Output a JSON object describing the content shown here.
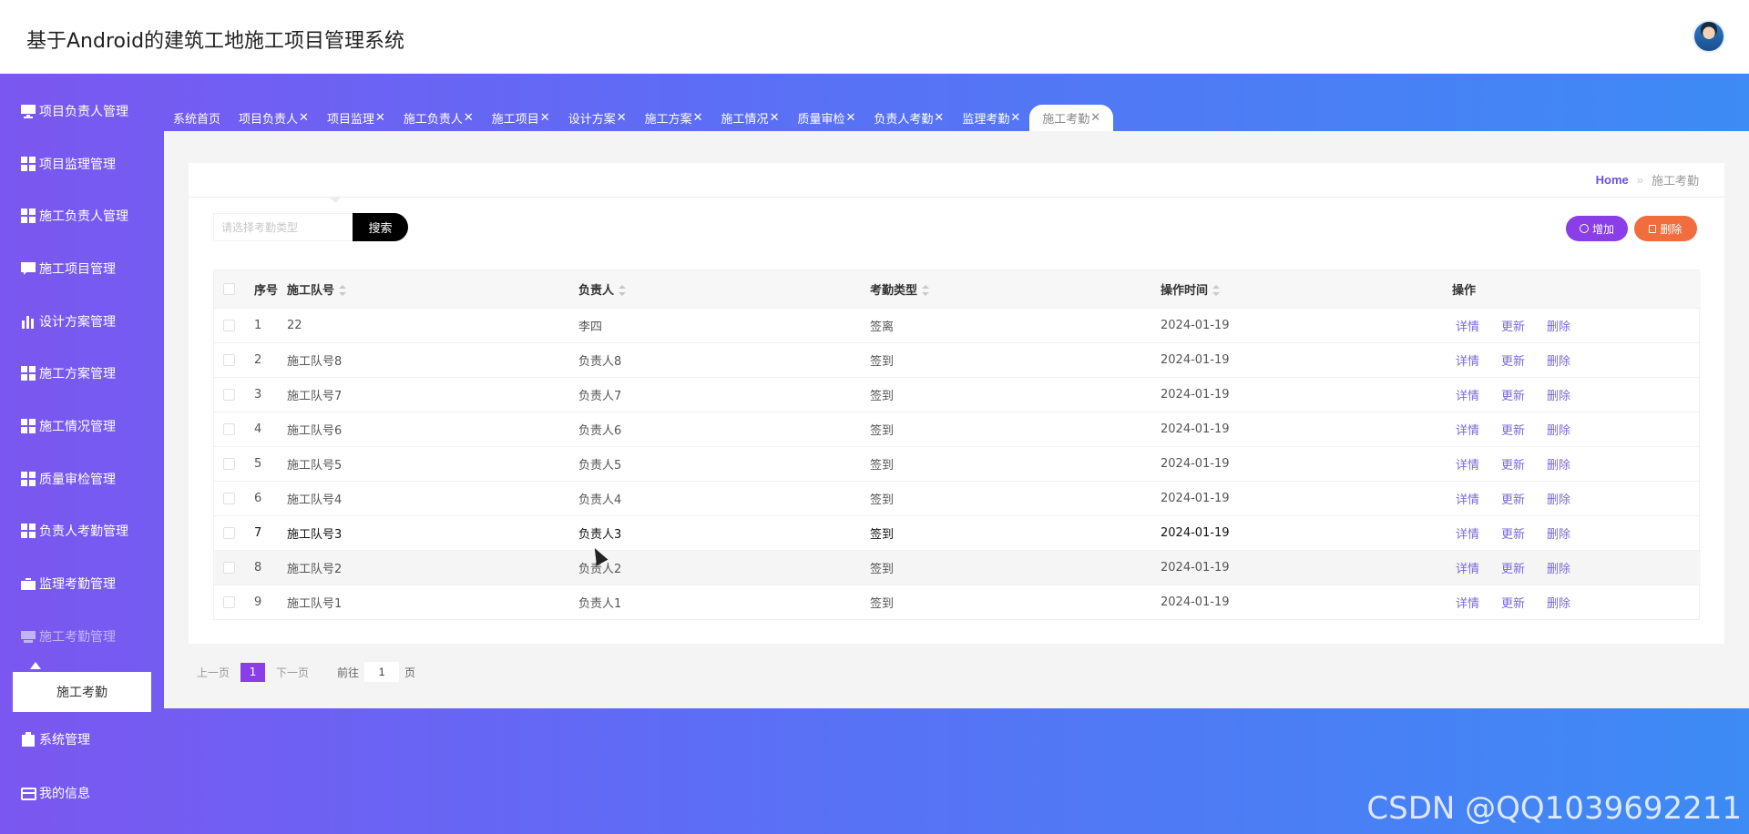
{
  "header": {
    "title": "基于Android的建筑工地施工项目管理系统"
  },
  "sidebar": {
    "items": [
      {
        "label": "项目负责人管理",
        "icon": "monitor-icon"
      },
      {
        "label": "项目监理管理",
        "icon": "grid-icon"
      },
      {
        "label": "施工负责人管理",
        "icon": "grid-icon"
      },
      {
        "label": "施工项目管理",
        "icon": "chat-icon"
      },
      {
        "label": "设计方案管理",
        "icon": "bar-chart-icon"
      },
      {
        "label": "施工方案管理",
        "icon": "grid-icon"
      },
      {
        "label": "施工情况管理",
        "icon": "grid-icon"
      },
      {
        "label": "质量审检管理",
        "icon": "grid-icon"
      },
      {
        "label": "负责人考勤管理",
        "icon": "grid-icon"
      },
      {
        "label": "监理考勤管理",
        "icon": "briefcase-icon"
      },
      {
        "label": "施工考勤管理",
        "icon": "printer-icon"
      },
      {
        "label": "系统管理",
        "icon": "clipboard-icon"
      },
      {
        "label": "我的信息",
        "icon": "card-icon"
      }
    ],
    "submenu_label": "施工考勤"
  },
  "tabs": [
    {
      "label": "系统首页",
      "close": ""
    },
    {
      "label": "项目负责人",
      "close": "✕"
    },
    {
      "label": "项目监理",
      "close": "✕"
    },
    {
      "label": "施工负责人",
      "close": "✕"
    },
    {
      "label": "施工项目",
      "close": "✕"
    },
    {
      "label": "设计方案",
      "close": "✕"
    },
    {
      "label": "施工方案",
      "close": "✕"
    },
    {
      "label": "施工情况",
      "close": "✕"
    },
    {
      "label": "质量审检",
      "close": "✕"
    },
    {
      "label": "负责人考勤",
      "close": "✕"
    },
    {
      "label": "监理考勤",
      "close": "✕"
    },
    {
      "label": "施工考勤",
      "close": "✕"
    }
  ],
  "breadcrumb": {
    "home": "Home",
    "separator": "»",
    "current": "施工考勤"
  },
  "search": {
    "placeholder": "请选择考勤类型",
    "button": "搜索"
  },
  "actions": {
    "add": "增加",
    "delete": "删除"
  },
  "table": {
    "headers": [
      "序号",
      "施工队号",
      "负责人",
      "考勤类型",
      "操作时间",
      "操作"
    ],
    "row_actions": [
      "详情",
      "更新",
      "删除"
    ],
    "rows": [
      [
        "1",
        "22",
        "李四",
        "签离",
        "2024-01-19"
      ],
      [
        "2",
        "施工队号8",
        "负责人8",
        "签到",
        "2024-01-19"
      ],
      [
        "3",
        "施工队号7",
        "负责人7",
        "签到",
        "2024-01-19"
      ],
      [
        "4",
        "施工队号6",
        "负责人6",
        "签到",
        "2024-01-19"
      ],
      [
        "5",
        "施工队号5",
        "负责人5",
        "签到",
        "2024-01-19"
      ],
      [
        "6",
        "施工队号4",
        "负责人4",
        "签到",
        "2024-01-19"
      ],
      [
        "7",
        "施工队号3",
        "负责人3",
        "签到",
        "2024-01-19"
      ],
      [
        "8",
        "施工队号2",
        "负责人2",
        "签到",
        "2024-01-19"
      ],
      [
        "9",
        "施工队号1",
        "负责人1",
        "签到",
        "2024-01-19"
      ]
    ]
  },
  "pagination": {
    "prev": "上一页",
    "current": "1",
    "next": "下一页",
    "goto_label": "前往",
    "goto_value": "1",
    "unit": "页"
  },
  "watermark": "CSDN @QQ1039692211",
  "colors": {
    "accent": "#8a3ee8",
    "danger": "#f26d3e",
    "gradient_start": "#7b57f0",
    "gradient_end": "#3d8bf5"
  }
}
